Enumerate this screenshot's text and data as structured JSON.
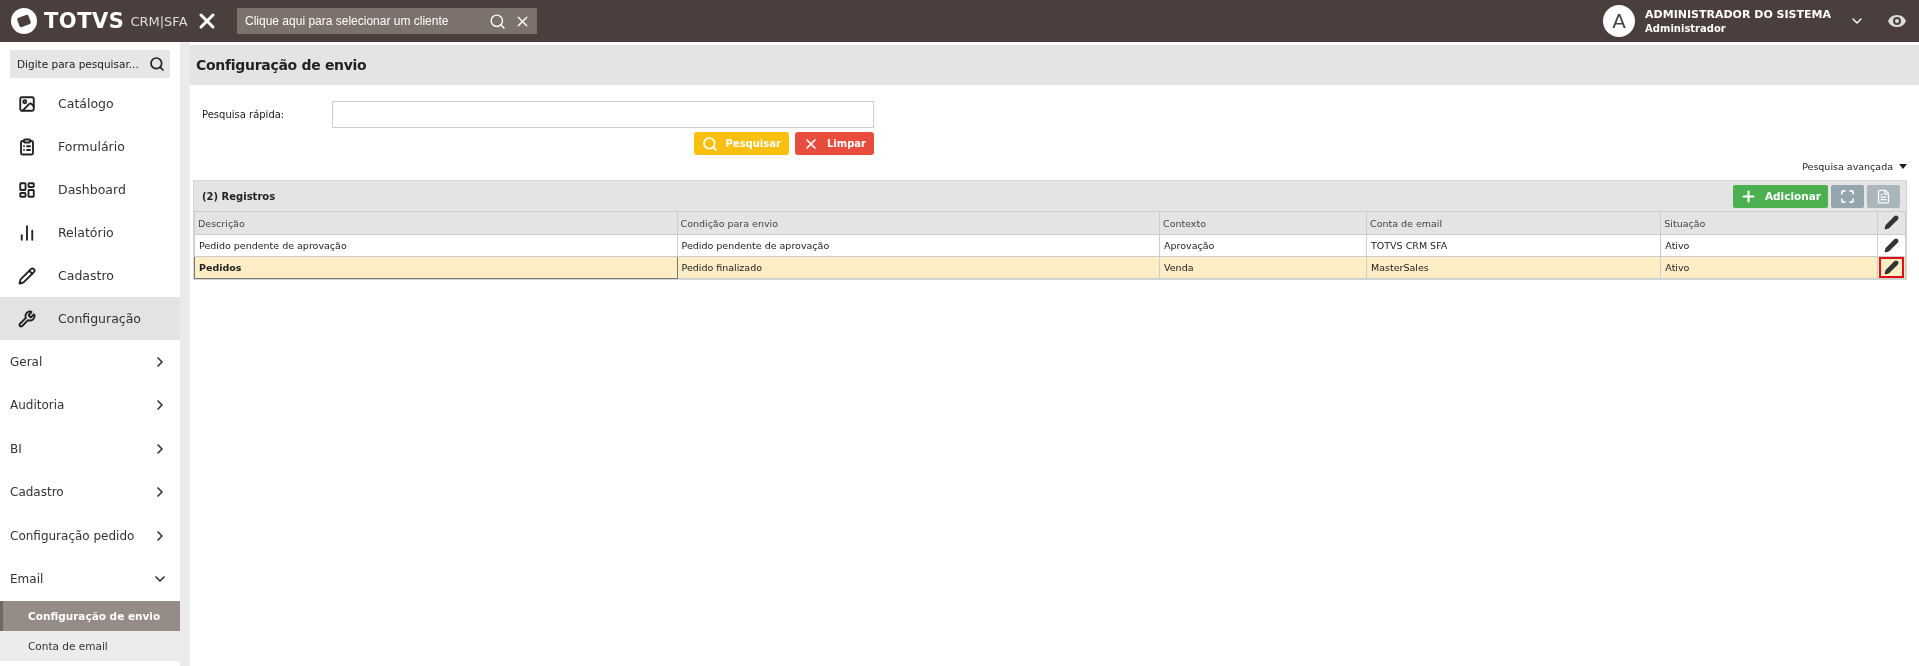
{
  "header": {
    "brand": "TOTVS",
    "product": "CRM|SFA",
    "client_search": {
      "placeholder": "Clique aqui para selecionar um cliente"
    },
    "user": {
      "initial": "A",
      "name": "ADMINISTRADOR DO SISTEMA",
      "role": "Administrador"
    }
  },
  "sidebar": {
    "search": {
      "placeholder": "Digite para pesquisar..."
    },
    "items": [
      {
        "label": "Catálogo",
        "selected": false
      },
      {
        "label": "Formulário",
        "selected": false
      },
      {
        "label": "Dashboard",
        "selected": false
      },
      {
        "label": "Relatório",
        "selected": false
      },
      {
        "label": "Cadastro",
        "selected": false
      },
      {
        "label": "Configuração",
        "selected": true
      }
    ],
    "submenu": [
      {
        "label": "Geral",
        "expanded": false
      },
      {
        "label": "Auditoria",
        "expanded": false
      },
      {
        "label": "BI",
        "expanded": false
      },
      {
        "label": "Cadastro",
        "expanded": false
      },
      {
        "label": "Configuração pedido",
        "expanded": false
      },
      {
        "label": "Email",
        "expanded": true,
        "children": [
          {
            "label": "Configuração de envio",
            "selected": true
          },
          {
            "label": "Conta de email",
            "selected": false
          }
        ]
      }
    ]
  },
  "page": {
    "title": "Configuração de envio",
    "quick_search": {
      "label": "Pesquisa rápida:"
    },
    "buttons": [
      {
        "kind": "search",
        "label": "Pesquisar"
      },
      {
        "kind": "clear",
        "label": "Limpar"
      }
    ],
    "advanced_search": "Pesquisa avançada"
  },
  "table": {
    "count": "(2) Registros",
    "add_button": "Adicionar",
    "columns": [
      "Descrição",
      "Condição para envio",
      "Contexto",
      "Conta de email",
      "Situação"
    ],
    "rows": [
      {
        "cells": [
          "Pedido pendente de aprovação",
          "Pedido pendente de aprovação",
          "Aprovação",
          "TOTVS CRM SFA",
          "Ativo"
        ],
        "selected": false,
        "edit_highlighted": false
      },
      {
        "cells": [
          "Pedidos",
          "Pedido finalizado",
          "Venda",
          "MasterSales",
          "Ativo"
        ],
        "selected": true,
        "edit_highlighted": true
      }
    ]
  }
}
